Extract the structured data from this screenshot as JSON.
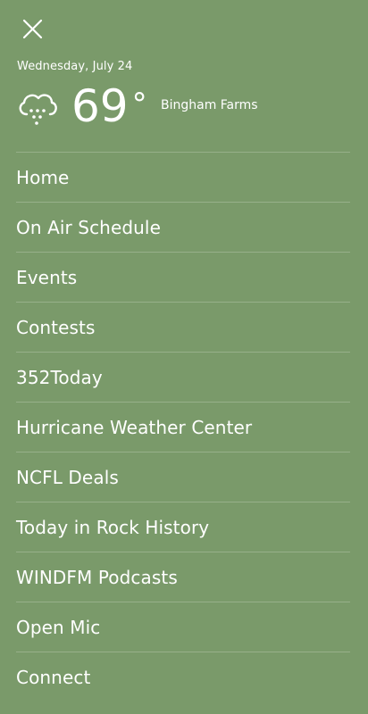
{
  "header": {
    "close_icon": "close-icon",
    "date": "Wednesday, July 24"
  },
  "weather": {
    "icon": "rain-cloud-icon",
    "temperature": "69",
    "degree_symbol": "°",
    "location": "Bingham Farms"
  },
  "menu": {
    "items": [
      {
        "label": "Home"
      },
      {
        "label": "On Air Schedule"
      },
      {
        "label": "Events"
      },
      {
        "label": "Contests"
      },
      {
        "label": "352Today"
      },
      {
        "label": "Hurricane Weather Center"
      },
      {
        "label": "NCFL Deals"
      },
      {
        "label": "Today in Rock History"
      },
      {
        "label": "WINDFM Podcasts"
      },
      {
        "label": "Open Mic"
      },
      {
        "label": "Connect"
      }
    ]
  },
  "colors": {
    "background": "#7a9a6a",
    "text": "#ffffff"
  }
}
